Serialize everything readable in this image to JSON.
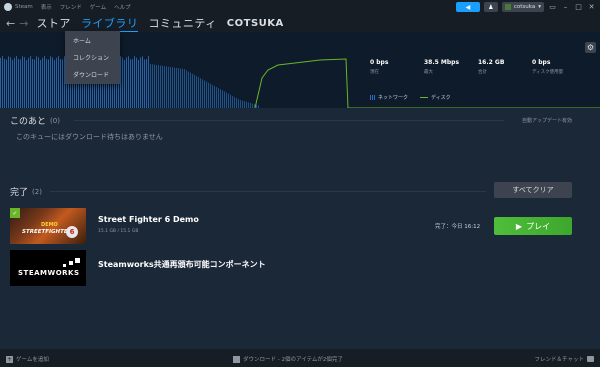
{
  "menubar": {
    "items": [
      "Steam",
      "表示",
      "フレンド",
      "ゲーム",
      "ヘルプ"
    ],
    "username": "cotsuka"
  },
  "nav": {
    "tabs": [
      "ストア",
      "ライブラリ",
      "コミュニティ",
      "COTSUKA"
    ],
    "active_index": 1
  },
  "library_dropdown": [
    "ホーム",
    "コレクション",
    "ダウンロード"
  ],
  "graph": {
    "stats": [
      {
        "value": "0 bps",
        "label": "現在"
      },
      {
        "value": "38.5 Mbps",
        "label": "最大"
      },
      {
        "value": "16.2 GB",
        "label": "合計"
      },
      {
        "value": "0 bps",
        "label": "ディスク使用量"
      }
    ],
    "legend": [
      "ネットワーク",
      "ディスク"
    ],
    "network_color": "#2a6fbf",
    "disk_color": "#6bb52a"
  },
  "up_next": {
    "title": "このあと",
    "count": "(0)",
    "auto_update_note": "自動アップデート有効",
    "empty_message": "このキューにはダウンロード待ちはありません"
  },
  "completed": {
    "title": "完了",
    "count": "(2)",
    "clear_all_label": "すべてクリア",
    "items": [
      {
        "name": "Street Fighter 6 Demo",
        "size": "15.1 GB / 15.1 GB",
        "completed_time": "完了：今日 16:12",
        "play_label": "プレイ",
        "thumb_text_demo": "DEMO",
        "thumb_text_title": "STREETFIGHTER",
        "thumb_text_num": "6"
      },
      {
        "name": "Steamworks共通再頒布可能コンポーネント",
        "thumb_text": "STEAMWORKS"
      }
    ]
  },
  "bottombar": {
    "add_game": "ゲームを追加",
    "downloads_status": "ダウンロード - 2個のアイテムが2個完了",
    "friends_chat": "フレンド＆チャット"
  }
}
